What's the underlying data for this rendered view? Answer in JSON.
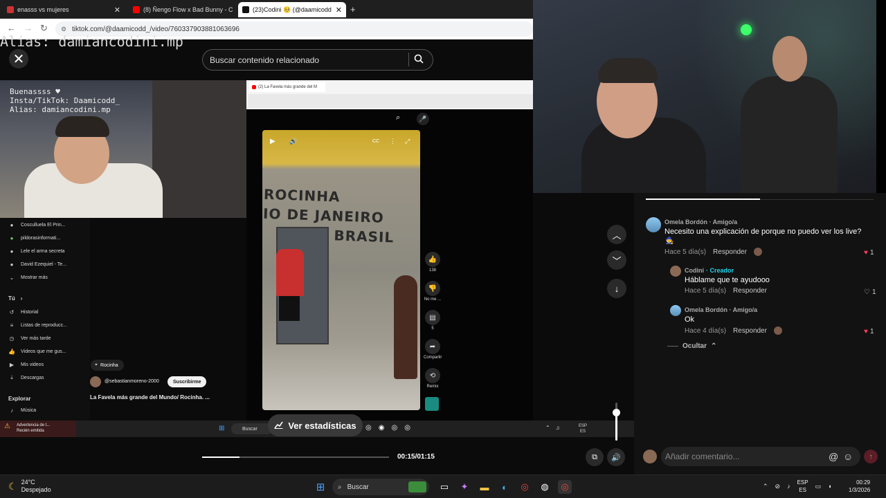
{
  "browser": {
    "tabs": [
      {
        "label": "enasss  vs  mujeres",
        "active": false
      },
      {
        "label": "(8) Ñengo Flow x Bad Bunny - C",
        "active": false
      },
      {
        "label": "(23)Codini 🥺 (@daamicodd",
        "active": true
      }
    ],
    "new_tab": "+",
    "url": "tiktok.com/@daamicodd_/video/760337903881063696"
  },
  "overlay": {
    "alias_text": "Alias: damiancodini.mp",
    "cam_text": "Buenassss ♥\nInsta/TikTok: Daamicodd_\nAlias: damiancodini.mp"
  },
  "search": {
    "placeholder": "Buscar contenido relacionado"
  },
  "inner": {
    "tab_label": "(2) La Favela más grande del M",
    "sidebar": [
      {
        "icon": "subs",
        "label": "Cosculluela El Prin..."
      },
      {
        "icon": "subs",
        "label": "pildorasinformati..."
      },
      {
        "icon": "subs",
        "label": "Lele el arma secreta"
      },
      {
        "icon": "subs",
        "label": "David Ezequiel - Te..."
      },
      {
        "icon": "chevron",
        "label": "Mostrar más"
      }
    ],
    "section_you": "Tú",
    "you_items": [
      {
        "icon": "↺",
        "label": "Historial"
      },
      {
        "icon": "≡",
        "label": "Listas de reproducc..."
      },
      {
        "icon": "◷",
        "label": "Ver más tarde"
      },
      {
        "icon": "👍",
        "label": "Videos que me gus..."
      },
      {
        "icon": "▶",
        "label": "Mis videos"
      },
      {
        "icon": "⤓",
        "label": "Descargas"
      }
    ],
    "section_explore": "Explorar",
    "explore_items": [
      {
        "icon": "♪",
        "label": "Música"
      }
    ],
    "short": {
      "wall_text": "ROCINHA\nIO DE JANEIRO\n             BRASIL",
      "location": "Rocinha",
      "channel": "@sebastianmoreno-2000",
      "subscribe": "Suscribirme",
      "title": "La Favela más grande del Mundo/ Rocinha. ...",
      "likes": "138",
      "dislike": "No me ...",
      "comments": "5",
      "share": "Compartir",
      "remix": "Remix"
    },
    "alert": {
      "title": "Advertencia de t...",
      "sub": "Recién emitida"
    },
    "taskbar_search": "Buscar",
    "lang": "ESP",
    "lang_sub": "ES"
  },
  "player": {
    "stats_label": "Ver estadísticas",
    "time": "00:15/01:15",
    "progress": 0.2,
    "volume": 0.75
  },
  "comments": [
    {
      "author": "Omela Bordón · Amigo/a",
      "text": "Necesito una explicación de porque no puedo ver los live?",
      "time": "Hace 5 día(s)",
      "reply": "Responder",
      "likes": "1",
      "liked": true,
      "level": 0
    },
    {
      "author": "Codini",
      "creator": "· Creador",
      "text": "Háblame que te ayudooo",
      "time": "Hace 5 día(s)",
      "reply": "Responder",
      "likes": "1",
      "liked": false,
      "level": 1
    },
    {
      "author": "Omela Bordón · Amigo/a",
      "text": "Ok",
      "time": "Hace 4 día(s)",
      "reply": "Responder",
      "likes": "1",
      "liked": true,
      "level": 1
    }
  ],
  "hide_label": "Ocultar",
  "add_comment": {
    "placeholder": "Añadir comentario..."
  },
  "taskbar": {
    "weather_temp": "24°C",
    "weather_desc": "Despejado",
    "search_label": "Buscar",
    "lang": "ESP",
    "lang_sub": "ES",
    "time": "00:29",
    "date": "1/3/2026"
  },
  "colors": {
    "like_red": "#ff3b5c",
    "creator_teal": "#20d5ec"
  }
}
